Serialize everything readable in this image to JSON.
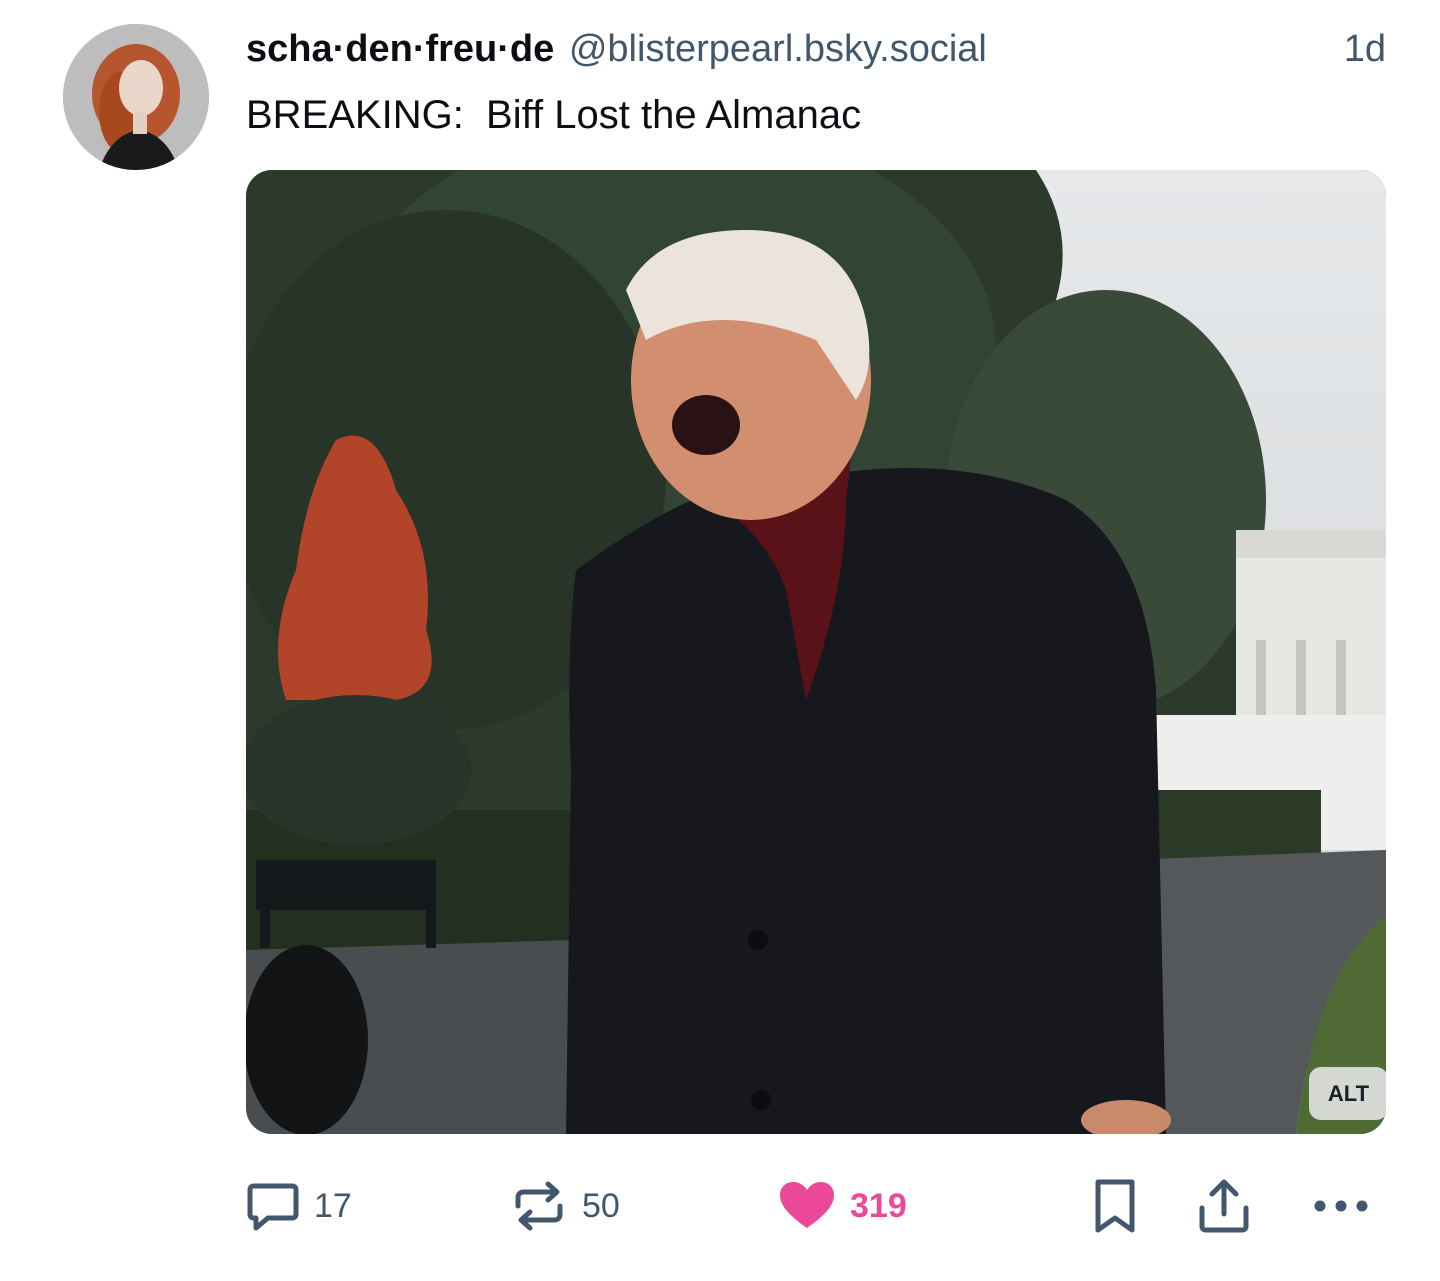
{
  "post": {
    "author": {
      "display_name": "scha·den·freu·de",
      "handle": "@blisterpearl.bsky.social"
    },
    "timestamp": "1d",
    "text": "BREAKING:  Biff Lost the Almanac",
    "media": {
      "alt_label": "ALT"
    },
    "actions": {
      "reply_count": "17",
      "repost_count": "50",
      "like_count": "319"
    }
  },
  "icons": {
    "reply": "speech-bubble-icon",
    "repost": "repost-arrows-icon",
    "like": "heart-icon",
    "bookmark": "bookmark-icon",
    "share": "share-upload-icon",
    "more": "ellipsis-icon"
  },
  "colors": {
    "text_primary": "#0b0f14",
    "text_secondary": "#42576c",
    "like_active": "#ec4899"
  }
}
